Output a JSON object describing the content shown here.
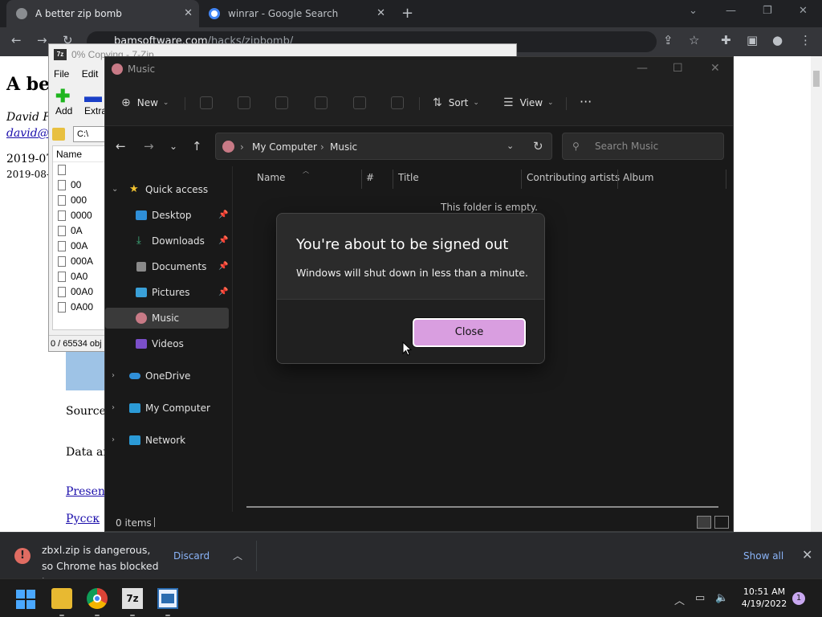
{
  "browser": {
    "tabs": [
      {
        "label": "A better zip bomb",
        "active": true
      },
      {
        "label": "winrar - Google Search",
        "active": false
      }
    ],
    "url_host": "bamsoftware.com",
    "url_path": "/hacks/zipbomb/"
  },
  "webpage": {
    "heading": "A bet",
    "author": "David F",
    "email": "david@",
    "date1": "2019-07",
    "date2": "2019-08-1",
    "source_label": "Source",
    "data_label": "Data an",
    "link1": "Presen",
    "link2": "Русск"
  },
  "zip7": {
    "title_progress": "0% Copying",
    "title_app": "7-Zip",
    "menu": [
      "File",
      "Edit"
    ],
    "tools": [
      "Add",
      "Extra"
    ],
    "path_prefix": "C:\\",
    "column_name": "Name",
    "files": [
      "",
      "00",
      "000",
      "0000",
      "0A",
      "00A",
      "000A",
      "0A0",
      "00A0",
      "0A00"
    ],
    "status": "0 / 65534 obj"
  },
  "explorer": {
    "title": "Music",
    "commands": {
      "new": "New",
      "sort": "Sort",
      "view": "View",
      "more": "···"
    },
    "breadcrumb": [
      "My Computer",
      "Music"
    ],
    "search_placeholder": "Search Music",
    "nav": {
      "quick_access": "Quick access",
      "desktop": "Desktop",
      "downloads": "Downloads",
      "documents": "Documents",
      "pictures": "Pictures",
      "music": "Music",
      "videos": "Videos",
      "onedrive": "OneDrive",
      "my_computer": "My Computer",
      "network": "Network"
    },
    "columns": [
      "Name",
      "#",
      "Title",
      "Contributing artists",
      "Album"
    ],
    "empty_message": "This folder is empty.",
    "item_count": "0 items"
  },
  "dialog": {
    "title": "You're about to be signed out",
    "message": "Windows will shut down in less than a minute.",
    "button": "Close",
    "button_color": "#d99ee0"
  },
  "download_bar": {
    "message": "zbxl.zip is dangerous, so Chrome has blocked it.",
    "discard": "Discard",
    "show_all": "Show all",
    "warning_icon": "!"
  },
  "taskbar": {
    "time": "10:51 AM",
    "date": "4/19/2022",
    "notification_count": "1",
    "app_7zip": "7z"
  }
}
